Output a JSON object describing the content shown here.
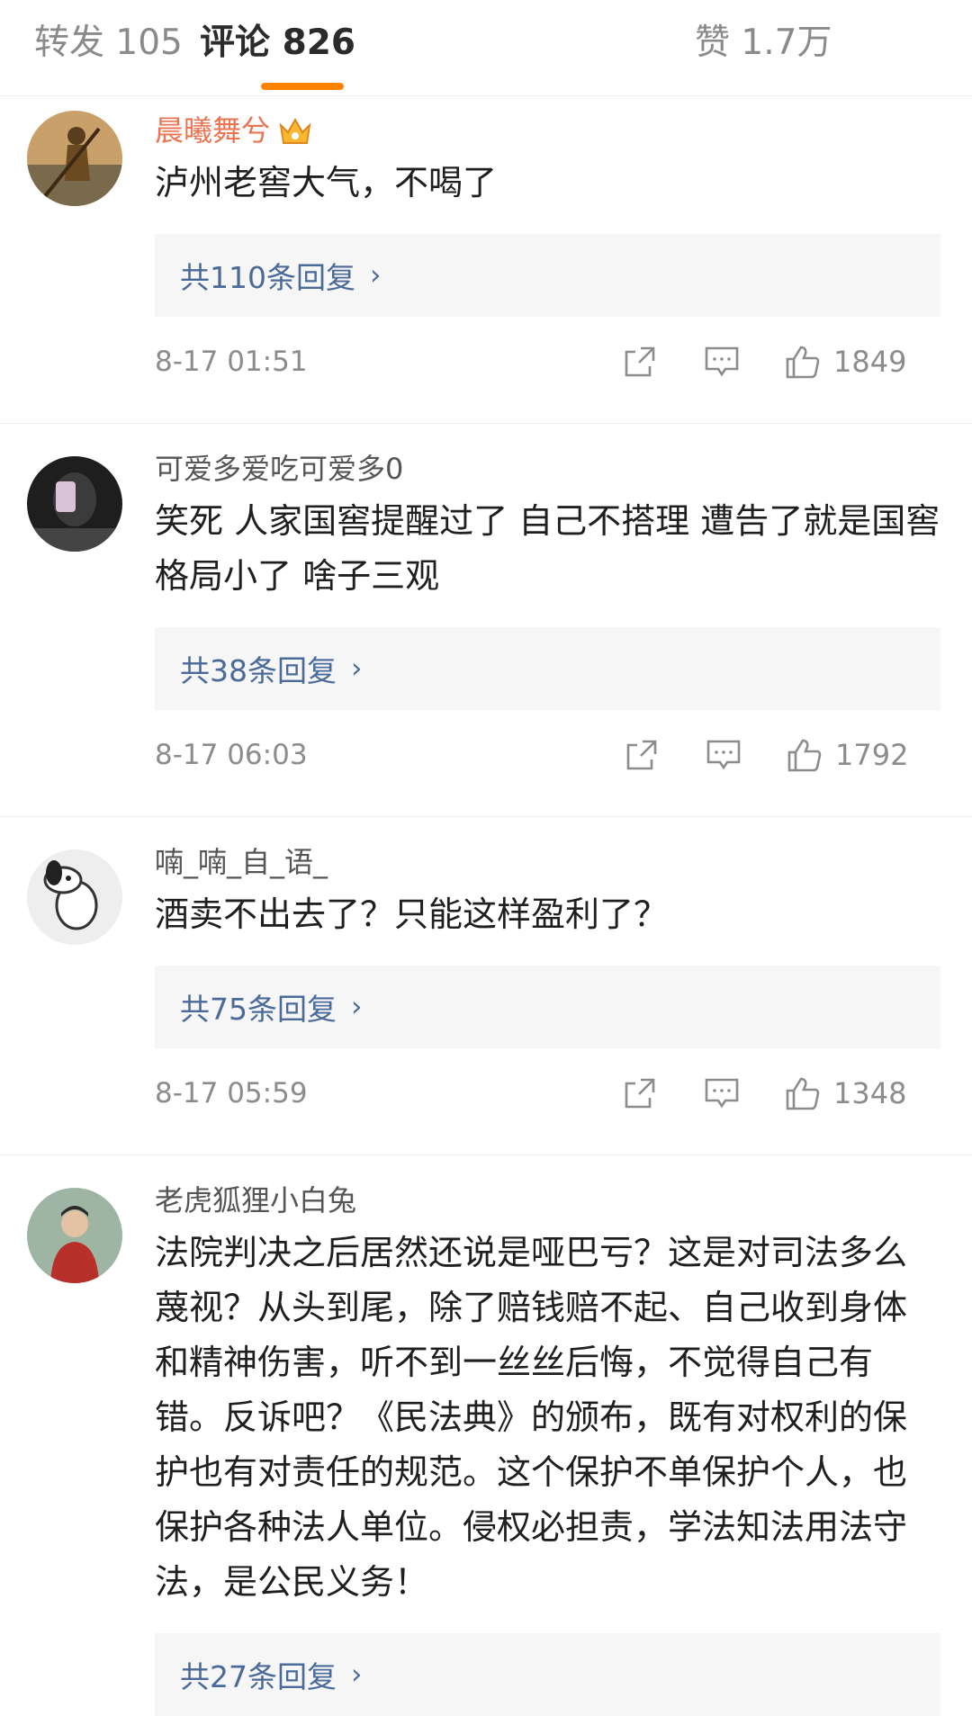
{
  "tabs": [
    {
      "label": "转发",
      "count": "105"
    },
    {
      "label": "评论",
      "count": "826"
    },
    {
      "label": "赞",
      "count": "1.7万"
    }
  ],
  "colors": {
    "accent": "#ff8200",
    "vip_name": "#eb7350",
    "reply_link": "#4a6a99"
  },
  "comments": [
    {
      "user": "晨曦舞兮",
      "badge": "crown-icon",
      "text": "泸州老窖大气，不喝了",
      "replies": "共110条回复",
      "time": "8-17 01:51",
      "likes": "1849"
    },
    {
      "user": "可爱多爱吃可爱多0",
      "text": "笑死  人家国窖提醒过了  自己不搭理  遭告了就是国窖格局小了  啥子三观",
      "replies": "共38条回复",
      "time": "8-17 06:03",
      "likes": "1792"
    },
    {
      "user": "喃_喃_自_语_",
      "text": "酒卖不出去了？只能这样盈利了？",
      "replies": "共75条回复",
      "time": "8-17 05:59",
      "likes": "1348"
    },
    {
      "user": "老虎狐狸小白兔",
      "text": "法院判决之后居然还说是哑巴亏？这是对司法多么蔑视？从头到尾，除了赔钱赔不起、自己收到身体和精神伤害，听不到一丝丝后悔，不觉得自己有错。反诉吧？《民法典》的颁布，既有对权利的保护也有对责任的规范。这个保护不单保护个人，也保护各种法人单位。侵权必担责，学法知法用法守法，是公民义务！",
      "replies": "共27条回复"
    }
  ]
}
